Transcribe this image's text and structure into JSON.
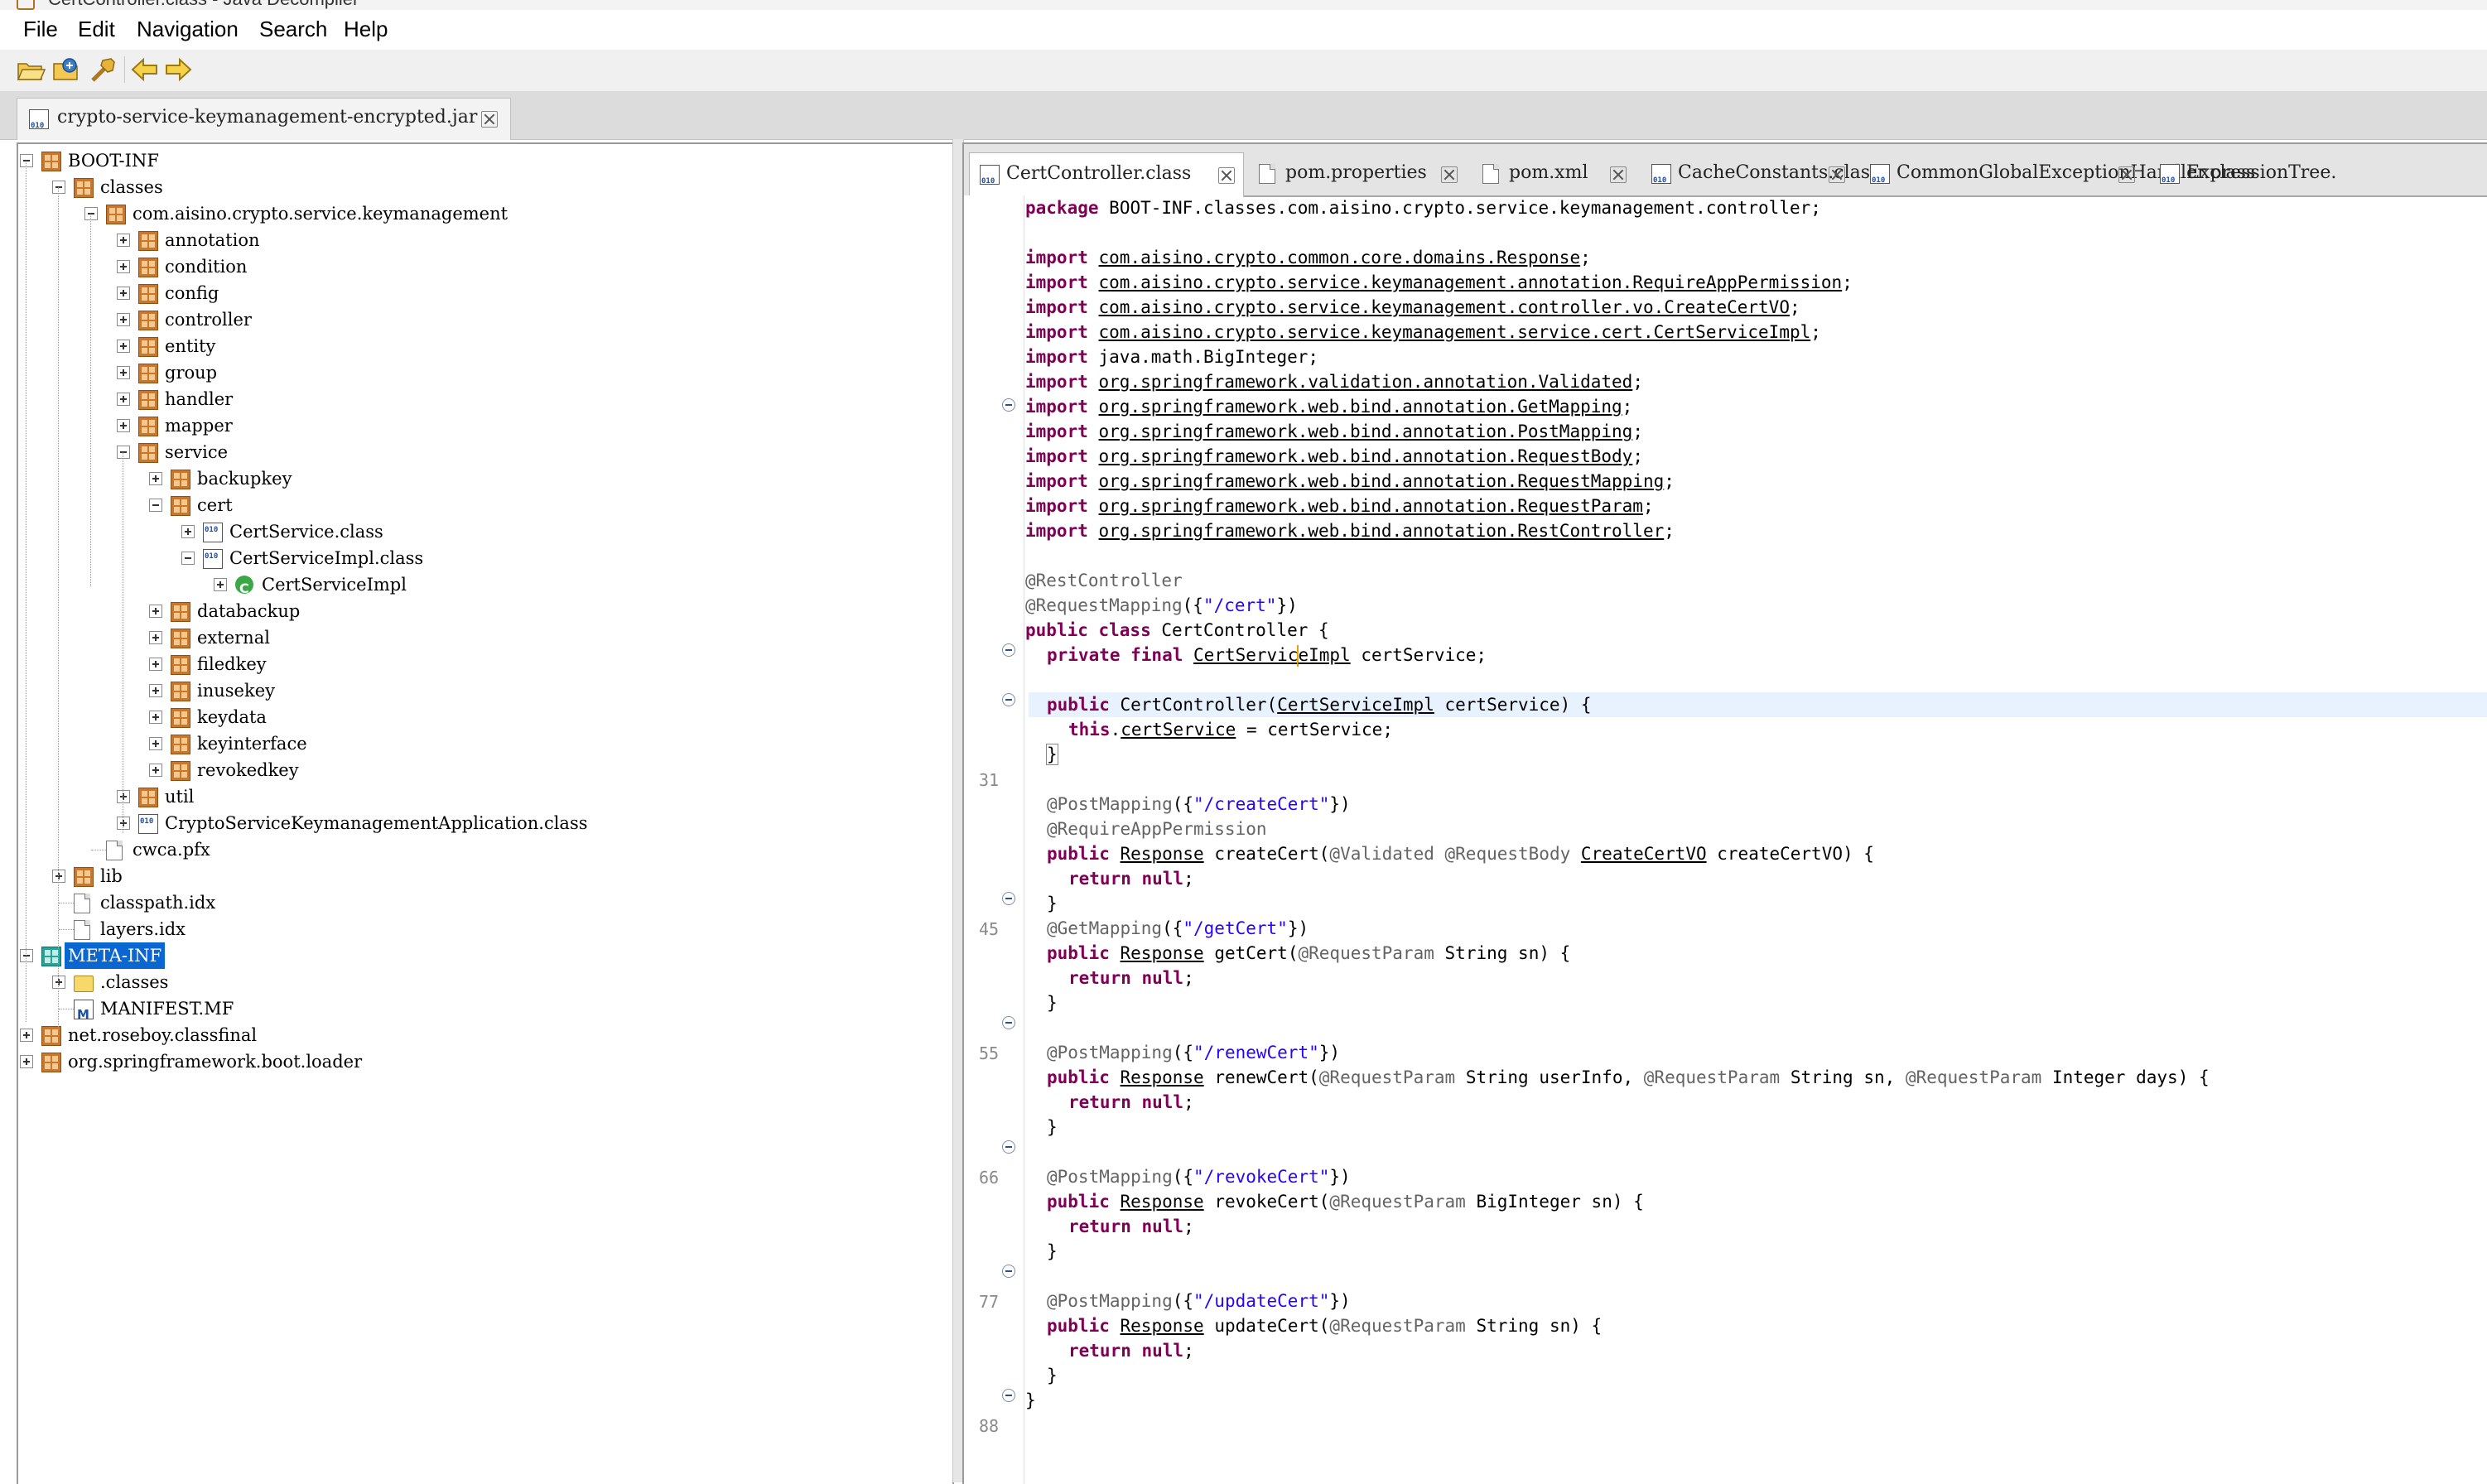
{
  "window": {
    "title": "CertController.class - Java Decompiler"
  },
  "menu": [
    "File",
    "Edit",
    "Navigation",
    "Search",
    "Help"
  ],
  "toolbar": {
    "open_file": "open-file-icon",
    "open_type": "open-type-icon",
    "search": "search-icon",
    "back": "back-arrow-icon",
    "forward": "forward-arrow-icon"
  },
  "jar_tab": {
    "label": "crypto-service-keymanagement-encrypted.jar"
  },
  "tree": [
    {
      "label": "BOOT-INF",
      "icon": "package",
      "expander": "minus"
    },
    {
      "label": "classes",
      "icon": "package",
      "expander": "minus"
    },
    {
      "label": "com.aisino.crypto.service.keymanagement",
      "icon": "package",
      "expander": "minus"
    },
    {
      "label": "annotation",
      "icon": "package",
      "expander": "plus"
    },
    {
      "label": "condition",
      "icon": "package",
      "expander": "plus"
    },
    {
      "label": "config",
      "icon": "package",
      "expander": "plus"
    },
    {
      "label": "controller",
      "icon": "package",
      "expander": "plus"
    },
    {
      "label": "entity",
      "icon": "package",
      "expander": "plus"
    },
    {
      "label": "group",
      "icon": "package",
      "expander": "plus"
    },
    {
      "label": "handler",
      "icon": "package",
      "expander": "plus"
    },
    {
      "label": "mapper",
      "icon": "package",
      "expander": "plus"
    },
    {
      "label": "service",
      "icon": "package",
      "expander": "minus"
    },
    {
      "label": "backupkey",
      "icon": "package",
      "expander": "plus"
    },
    {
      "label": "cert",
      "icon": "package",
      "expander": "minus"
    },
    {
      "label": "CertService.class",
      "icon": "class-file",
      "expander": "plus"
    },
    {
      "label": "CertServiceImpl.class",
      "icon": "class-file",
      "expander": "minus"
    },
    {
      "label": "CertServiceImpl",
      "icon": "class",
      "expander": "plus"
    },
    {
      "label": "databackup",
      "icon": "package",
      "expander": "plus"
    },
    {
      "label": "external",
      "icon": "package",
      "expander": "plus"
    },
    {
      "label": "filedkey",
      "icon": "package",
      "expander": "plus"
    },
    {
      "label": "inusekey",
      "icon": "package",
      "expander": "plus"
    },
    {
      "label": "keydata",
      "icon": "package",
      "expander": "plus"
    },
    {
      "label": "keyinterface",
      "icon": "package",
      "expander": "plus"
    },
    {
      "label": "revokedkey",
      "icon": "package",
      "expander": "plus"
    },
    {
      "label": "util",
      "icon": "package",
      "expander": "plus"
    },
    {
      "label": "CryptoServiceKeymanagementApplication.class",
      "icon": "class-file",
      "expander": "plus"
    },
    {
      "label": "cwca.pfx",
      "icon": "file",
      "expander": "none"
    },
    {
      "label": "lib",
      "icon": "package",
      "expander": "plus"
    },
    {
      "label": "classpath.idx",
      "icon": "file",
      "expander": "none"
    },
    {
      "label": "layers.idx",
      "icon": "file",
      "expander": "none"
    },
    {
      "label": "META-INF",
      "icon": "package-meta",
      "expander": "minus",
      "selected": true
    },
    {
      "label": ".classes",
      "icon": "folder",
      "expander": "plus"
    },
    {
      "label": "MANIFEST.MF",
      "icon": "manifest",
      "expander": "none"
    },
    {
      "label": "net.roseboy.classfinal",
      "icon": "package",
      "expander": "plus"
    },
    {
      "label": "org.springframework.boot.loader",
      "icon": "package",
      "expander": "plus"
    }
  ],
  "editor_tabs": [
    {
      "label": "CertController.class",
      "icon": "class-file",
      "active": true
    },
    {
      "label": "pom.properties",
      "icon": "file"
    },
    {
      "label": "pom.xml",
      "icon": "xml-file"
    },
    {
      "label": "CacheConstants.class",
      "icon": "class-file"
    },
    {
      "label": "CommonGlobalExceptionHandler.class",
      "icon": "class-file"
    },
    {
      "label": "ExpressionTree.",
      "icon": "class-file"
    }
  ],
  "line_numbers": [
    "31",
    "45",
    "55",
    "66",
    "77",
    "88"
  ],
  "code": {
    "package_decl": "BOOT-INF.classes.com.aisino.crypto.service.keymanagement.controller",
    "imports": [
      "com.aisino.crypto.common.core.domains.Response",
      "com.aisino.crypto.service.keymanagement.annotation.RequireAppPermission",
      "com.aisino.crypto.service.keymanagement.controller.vo.CreateCertVO",
      "com.aisino.crypto.service.keymanagement.service.cert.CertServiceImpl",
      "java.math.BigInteger",
      "org.springframework.validation.annotation.Validated",
      "org.springframework.web.bind.annotation.GetMapping",
      "org.springframework.web.bind.annotation.PostMapping",
      "org.springframework.web.bind.annotation.RequestBody",
      "org.springframework.web.bind.annotation.RequestMapping",
      "org.springframework.web.bind.annotation.RequestParam",
      "org.springframework.web.bind.annotation.RestController"
    ],
    "class_annotation": "@RestController",
    "request_mapping_annotation": "@RequestMapping",
    "request_mapping_path": "\"/cert\"",
    "class_name": "CertController",
    "field_type": "CertServiceImpl",
    "field_name": "certService",
    "methods": [
      {
        "mapping": "@PostMapping",
        "path": "\"/createCert\"",
        "name": "createCert"
      },
      {
        "mapping": "@GetMapping",
        "path": "\"/getCert\"",
        "name": "getCert"
      },
      {
        "mapping": "@PostMapping",
        "path": "\"/renewCert\"",
        "name": "renewCert"
      },
      {
        "mapping": "@PostMapping",
        "path": "\"/revokeCert\"",
        "name": "revokeCert"
      },
      {
        "mapping": "@PostMapping",
        "path": "\"/updateCert\"",
        "name": "updateCert"
      }
    ],
    "require_permission": "@RequireAppPermission",
    "return_type": "Response",
    "validated_ann": "@Validated",
    "request_body_ann": "@RequestBody",
    "request_param_ann": "@RequestParam",
    "create_param_type": "CreateCertVO",
    "create_param_name": "createCertVO",
    "string_type": "String",
    "sn_param": "sn",
    "user_info_param": "userInfo",
    "integer_type": "Integer",
    "days_param": "days",
    "biginteger_type": "BigInteger"
  },
  "colors": {
    "keyword": "#7f0055",
    "annotation": "#646464",
    "string": "#2a00ff",
    "selection": "#0a67d2",
    "current_line": "#e8f2fe"
  }
}
